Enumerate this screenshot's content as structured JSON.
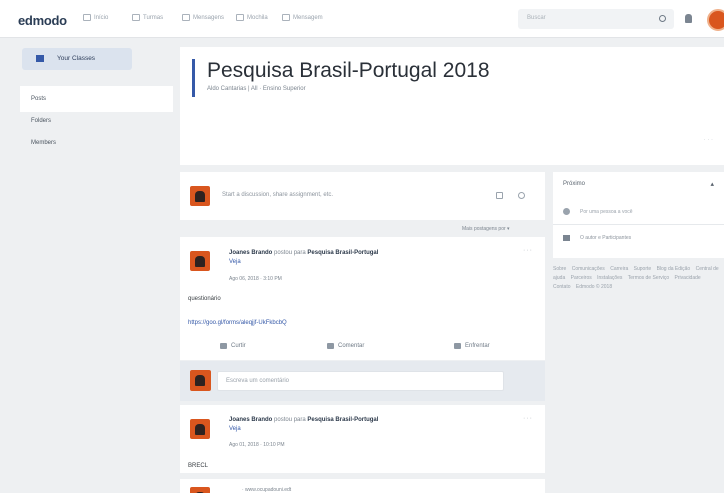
{
  "app": {
    "logo": "edmodo"
  },
  "nav": [
    {
      "label": "Início",
      "icon": "home-icon"
    },
    {
      "label": "Turmas",
      "icon": "classes-icon"
    },
    {
      "label": "Mensagens",
      "icon": "messages-icon"
    },
    {
      "label": "Mochila",
      "icon": "backpack-icon"
    },
    {
      "label": "Mensagem",
      "icon": "message-icon"
    }
  ],
  "search": {
    "placeholder": "Buscar"
  },
  "sidebar": {
    "classes_button": "Your Classes",
    "items": [
      {
        "label": "Posts"
      },
      {
        "label": "Folders"
      },
      {
        "label": "Members"
      }
    ]
  },
  "class_header": {
    "title": "Pesquisa Brasil-Portugal 2018",
    "subtitle": "Aldo Cantarias | All · Ensino Superior",
    "corner": "· · ·"
  },
  "composer": {
    "placeholder": "Start a discussion, share assignment, etc."
  },
  "filter": {
    "label": "Mais postagens por ▾"
  },
  "posts": [
    {
      "author": "Joanes Brando",
      "verb": "postou para",
      "target": "Pesquisa Brasil-Portugal",
      "view": "Veja",
      "date": "Ago 06, 2018 · 3:10 PM",
      "body": "questionário",
      "link": "https://goo.gl/forms/aleqjjf-UkFkbcbQ"
    },
    {
      "author": "Joanes Brando",
      "verb": "postou para",
      "target": "Pesquisa Brasil-Portugal",
      "view": "Veja",
      "date": "Ago 01, 2018 · 10:10 PM",
      "body": "BRECL"
    }
  ],
  "post_actions": {
    "like": "Curtir",
    "comment": "Comentar",
    "share": "Enfrentar"
  },
  "comment_box": {
    "placeholder": "Escreva um comentário"
  },
  "third_post": {
    "snippet": "· www.ocupadouni.edt"
  },
  "right_panel": {
    "title": "Próximo",
    "items": [
      {
        "label": "Por uma pessoa a você"
      },
      {
        "label": "O autor e Participantes"
      }
    ]
  },
  "footer": {
    "links": [
      "Sobre",
      "Comunicações",
      "Carreira",
      "Suporte",
      "Blog da Edição",
      "Central de ajuda",
      "Parceiros",
      "Instalações",
      "Termos de Serviço",
      "Privacidade",
      "Contato"
    ],
    "copyright": "Edmodo © 2018"
  }
}
